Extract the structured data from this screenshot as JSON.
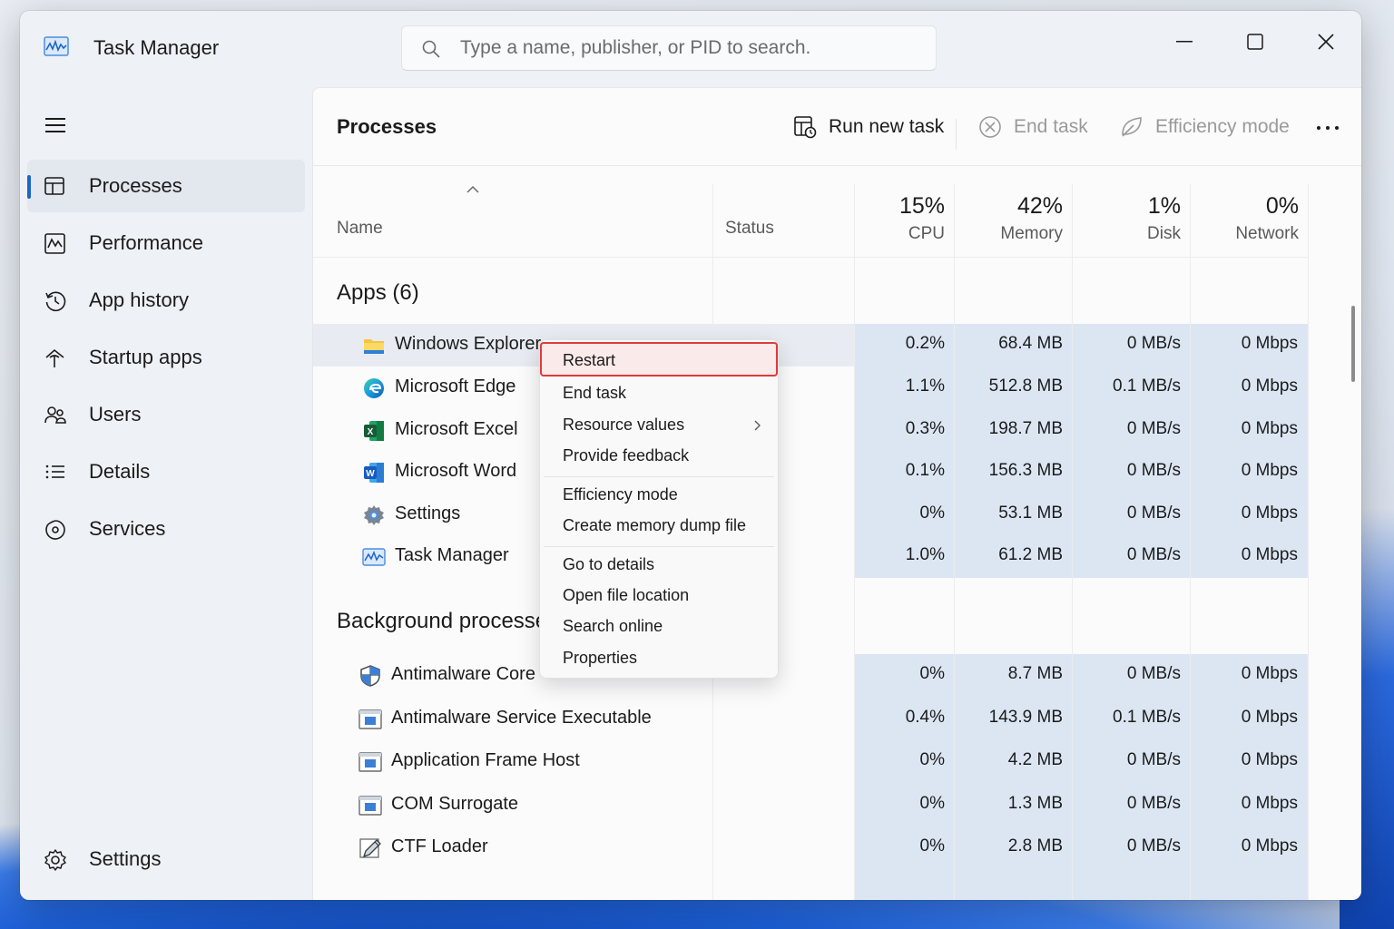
{
  "app": {
    "title": "Task Manager"
  },
  "search": {
    "placeholder": "Type a name, publisher, or PID to search."
  },
  "sidebar": {
    "items": [
      {
        "label": "Processes",
        "icon": "processes-icon",
        "active": true
      },
      {
        "label": "Performance",
        "icon": "performance-icon"
      },
      {
        "label": "App history",
        "icon": "app-history-icon"
      },
      {
        "label": "Startup apps",
        "icon": "startup-apps-icon"
      },
      {
        "label": "Users",
        "icon": "users-icon"
      },
      {
        "label": "Details",
        "icon": "details-icon"
      },
      {
        "label": "Services",
        "icon": "services-icon"
      }
    ],
    "settings_label": "Settings"
  },
  "toolbar": {
    "title": "Processes",
    "run_new_task": "Run new task",
    "end_task": "End task",
    "efficiency_mode": "Efficiency mode"
  },
  "columns": {
    "name": "Name",
    "status": "Status",
    "cpu": {
      "pct": "15%",
      "label": "CPU"
    },
    "memory": {
      "pct": "42%",
      "label": "Memory"
    },
    "disk": {
      "pct": "1%",
      "label": "Disk"
    },
    "network": {
      "pct": "0%",
      "label": "Network"
    }
  },
  "groups": {
    "apps_title": "Apps (6)",
    "background_title": "Background processes"
  },
  "apps": [
    {
      "name": "Windows Explorer",
      "icon": "folder-icon",
      "cpu": "0.2%",
      "memory": "68.4 MB",
      "disk": "0 MB/s",
      "network": "0 Mbps"
    },
    {
      "name": "Microsoft Edge",
      "icon": "edge-icon",
      "cpu": "1.1%",
      "memory": "512.8 MB",
      "disk": "0.1 MB/s",
      "network": "0 Mbps"
    },
    {
      "name": "Microsoft Excel",
      "icon": "excel-icon",
      "cpu": "0.3%",
      "memory": "198.7 MB",
      "disk": "0 MB/s",
      "network": "0 Mbps"
    },
    {
      "name": "Microsoft Word",
      "icon": "word-icon",
      "cpu": "0.1%",
      "memory": "156.3 MB",
      "disk": "0 MB/s",
      "network": "0 Mbps"
    },
    {
      "name": "Settings",
      "icon": "settings-gear-icon",
      "cpu": "0%",
      "memory": "53.1 MB",
      "disk": "0 MB/s",
      "network": "0 Mbps"
    },
    {
      "name": "Task Manager",
      "icon": "task-manager-icon",
      "cpu": "1.0%",
      "memory": "61.2 MB",
      "disk": "0 MB/s",
      "network": "0 Mbps"
    }
  ],
  "background": [
    {
      "name": "Antimalware Core Service",
      "icon": "shield-icon",
      "cpu": "0%",
      "memory": "8.7 MB",
      "disk": "0 MB/s",
      "network": "0 Mbps"
    },
    {
      "name": "Antimalware Service Executable",
      "icon": "window-app-icon",
      "cpu": "0.4%",
      "memory": "143.9 MB",
      "disk": "0.1 MB/s",
      "network": "0 Mbps"
    },
    {
      "name": "Application Frame Host",
      "icon": "window-app-icon",
      "cpu": "0%",
      "memory": "4.2 MB",
      "disk": "0 MB/s",
      "network": "0 Mbps"
    },
    {
      "name": "COM Surrogate",
      "icon": "window-app-icon",
      "cpu": "0%",
      "memory": "1.3 MB",
      "disk": "0 MB/s",
      "network": "0 Mbps"
    },
    {
      "name": "CTF Loader",
      "icon": "pen-icon",
      "cpu": "0%",
      "memory": "2.8 MB",
      "disk": "0 MB/s",
      "network": "0 Mbps"
    }
  ],
  "context_menu": {
    "items": [
      {
        "label": "Restart",
        "focused": true
      },
      {
        "label": "End task"
      },
      {
        "label": "Resource values",
        "submenu": true
      },
      {
        "label": "Provide feedback"
      },
      {
        "label": "Efficiency mode"
      },
      {
        "label": "Create memory dump file"
      },
      {
        "label": "Go to details"
      },
      {
        "label": "Open file location"
      },
      {
        "label": "Search online"
      },
      {
        "label": "Properties"
      }
    ]
  },
  "colors": {
    "accent": "#1a66c9",
    "heat": "#dce6f3",
    "focus_border": "#e03a3a"
  }
}
